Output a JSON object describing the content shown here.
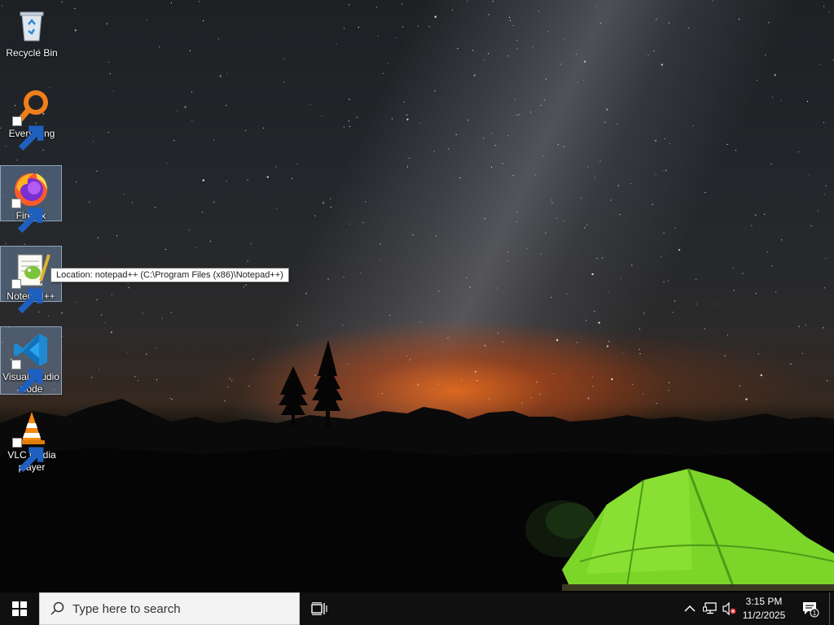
{
  "desktop": {
    "icons": [
      {
        "label": "Recycle Bin",
        "icon": "recycle-bin-icon",
        "shortcut": false,
        "selected": false
      },
      {
        "label": "Everything",
        "icon": "everything-search-icon",
        "shortcut": true,
        "selected": false
      },
      {
        "label": "Firefox",
        "icon": "firefox-icon",
        "shortcut": true,
        "selected": true
      },
      {
        "label": "Notepad++",
        "icon": "notepad-plus-plus-icon",
        "shortcut": true,
        "selected": true
      },
      {
        "label": "Visual Studio Code",
        "icon": "vscode-icon",
        "shortcut": true,
        "selected": true
      },
      {
        "label": "VLC media player",
        "icon": "vlc-icon",
        "shortcut": true,
        "selected": false
      }
    ],
    "tooltip": "Location: notepad++ (C:\\Program Files (x86)\\Notepad++)"
  },
  "taskbar": {
    "start_icon": "windows-logo-icon",
    "search_placeholder": "Type here to search",
    "task_view_icon": "task-view-icon",
    "tray": {
      "chevron_icon": "chevron-up-icon",
      "network_icon": "network-icon",
      "volume_icon": "volume-muted-icon",
      "time": "3:15 PM",
      "date": "11/2/2025",
      "notification_count": "1"
    }
  },
  "colors": {
    "taskbar": "#101010",
    "tent": "#7cd62a",
    "selection": "#7896be"
  }
}
